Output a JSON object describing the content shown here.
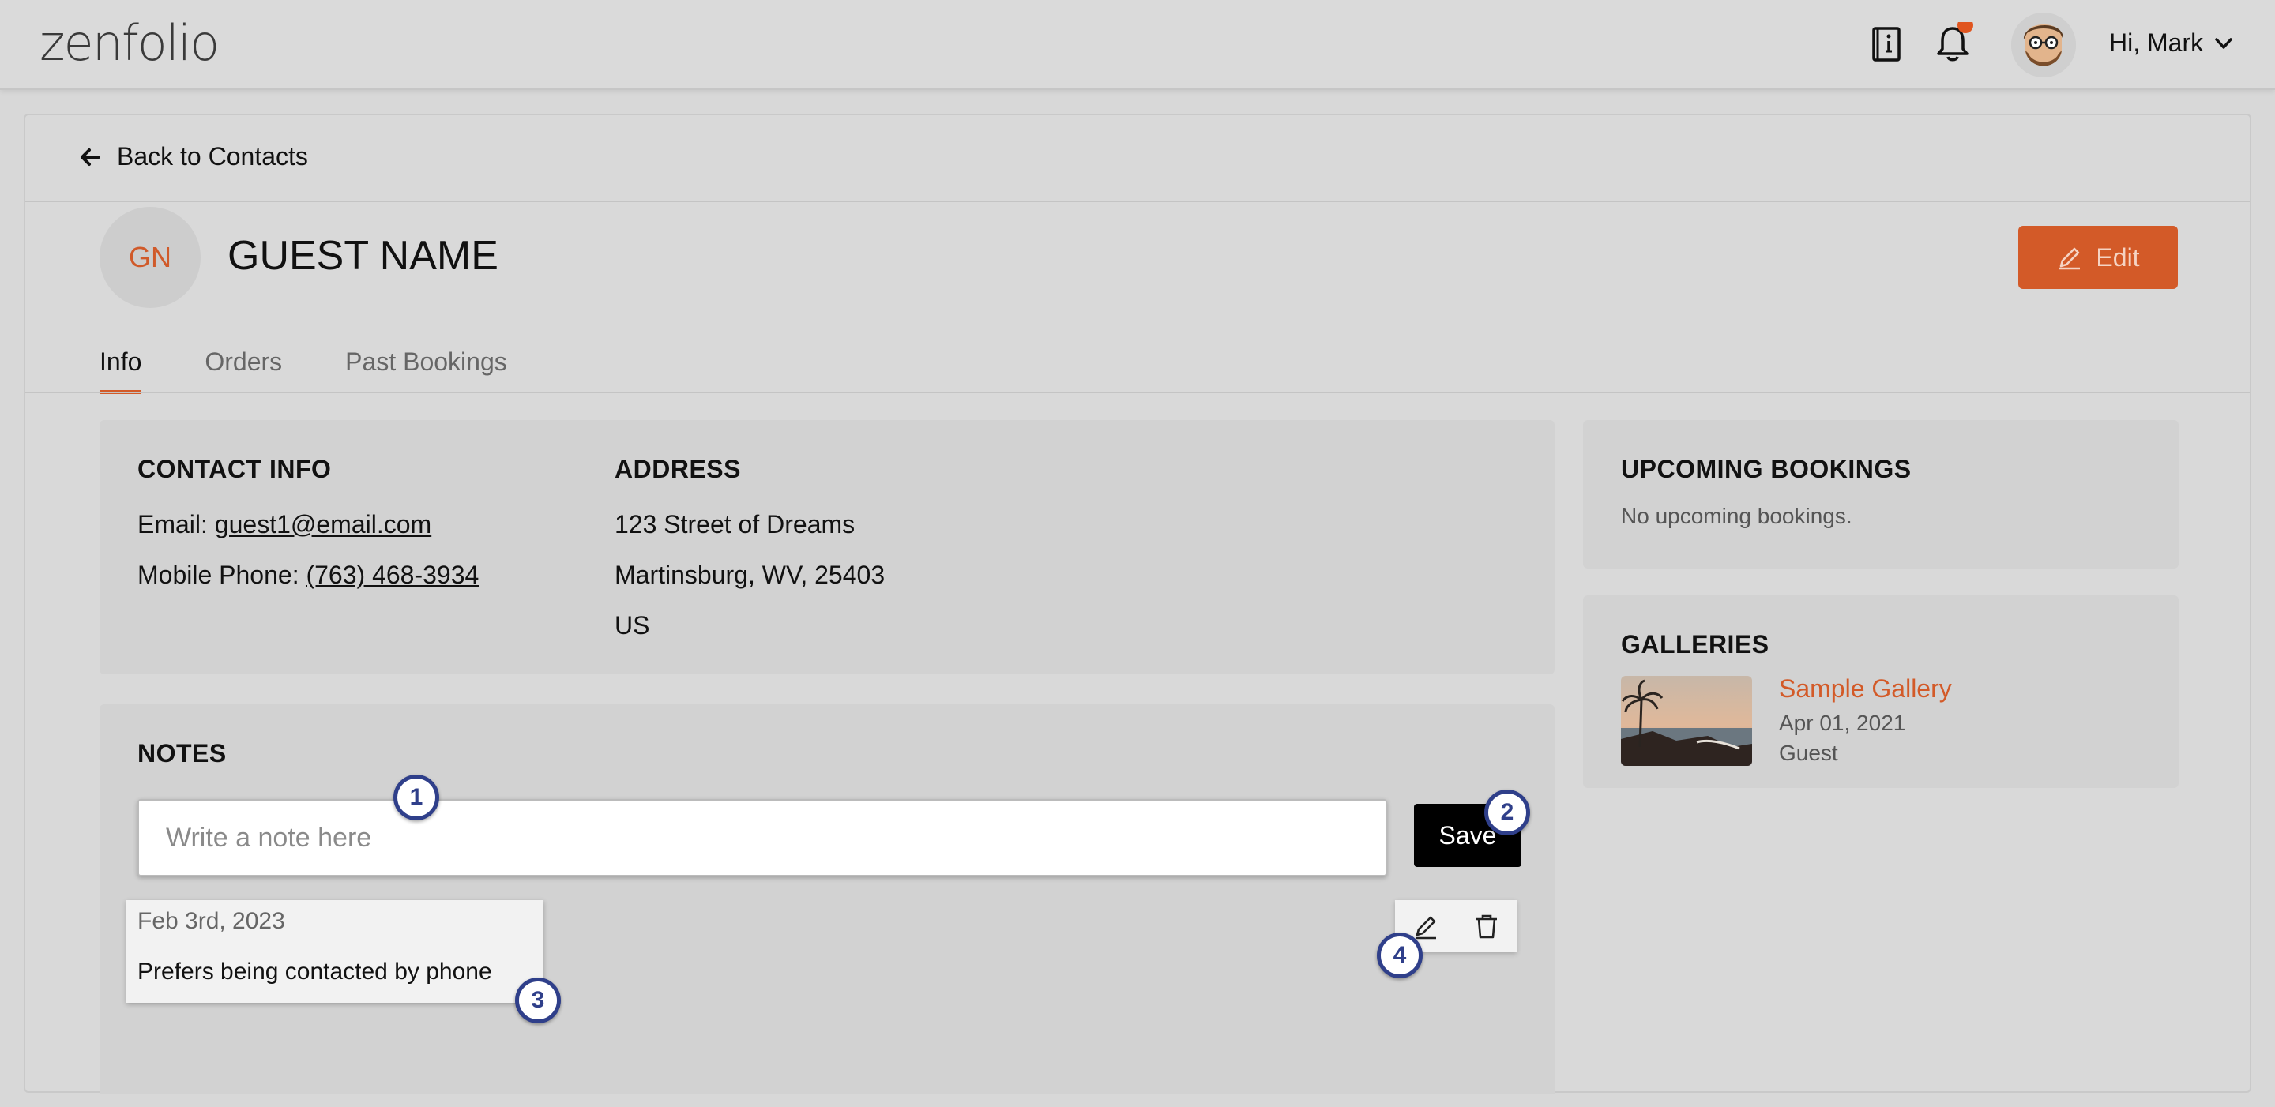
{
  "app": {
    "logo_text": "zenfolio",
    "greeting": "Hi, Mark"
  },
  "icons": {
    "guide": "book-info-icon",
    "notifications": "bell-icon",
    "avatar": "user-avatar",
    "menu": "chevron-down-icon",
    "back": "arrow-left-icon",
    "edit": "pencil-icon",
    "delete": "trash-icon"
  },
  "colors": {
    "accent": "#d35a28",
    "notification_dot": "#e0551f",
    "marker": "#2f3f8a"
  },
  "header": {
    "back_label": "Back to Contacts",
    "initials": "GN",
    "name": "GUEST NAME",
    "edit_label": "Edit"
  },
  "tabs": [
    {
      "label": "Info",
      "active": true
    },
    {
      "label": "Orders",
      "active": false
    },
    {
      "label": "Past Bookings",
      "active": false
    }
  ],
  "contact": {
    "title": "CONTACT INFO",
    "email_label": "Email: ",
    "email": "guest1@email.com",
    "phone_label": "Mobile Phone: ",
    "phone": "(763) 468-3934"
  },
  "address": {
    "title": "ADDRESS",
    "line1": "123 Street of Dreams",
    "line2": "Martinsburg, WV, 25403",
    "country": "US"
  },
  "notes": {
    "title": "NOTES",
    "placeholder": "Write a note here",
    "save_label": "Save",
    "items": [
      {
        "date": "Feb 3rd, 2023",
        "text": "Prefers being contacted by phone"
      }
    ]
  },
  "upcoming": {
    "title": "UPCOMING BOOKINGS",
    "empty_text": "No upcoming bookings."
  },
  "galleries": {
    "title": "GALLERIES",
    "items": [
      {
        "name": "Sample Gallery",
        "date": "Apr 01, 2021",
        "role": "Guest"
      }
    ]
  },
  "markers": [
    "1",
    "2",
    "3",
    "4"
  ]
}
